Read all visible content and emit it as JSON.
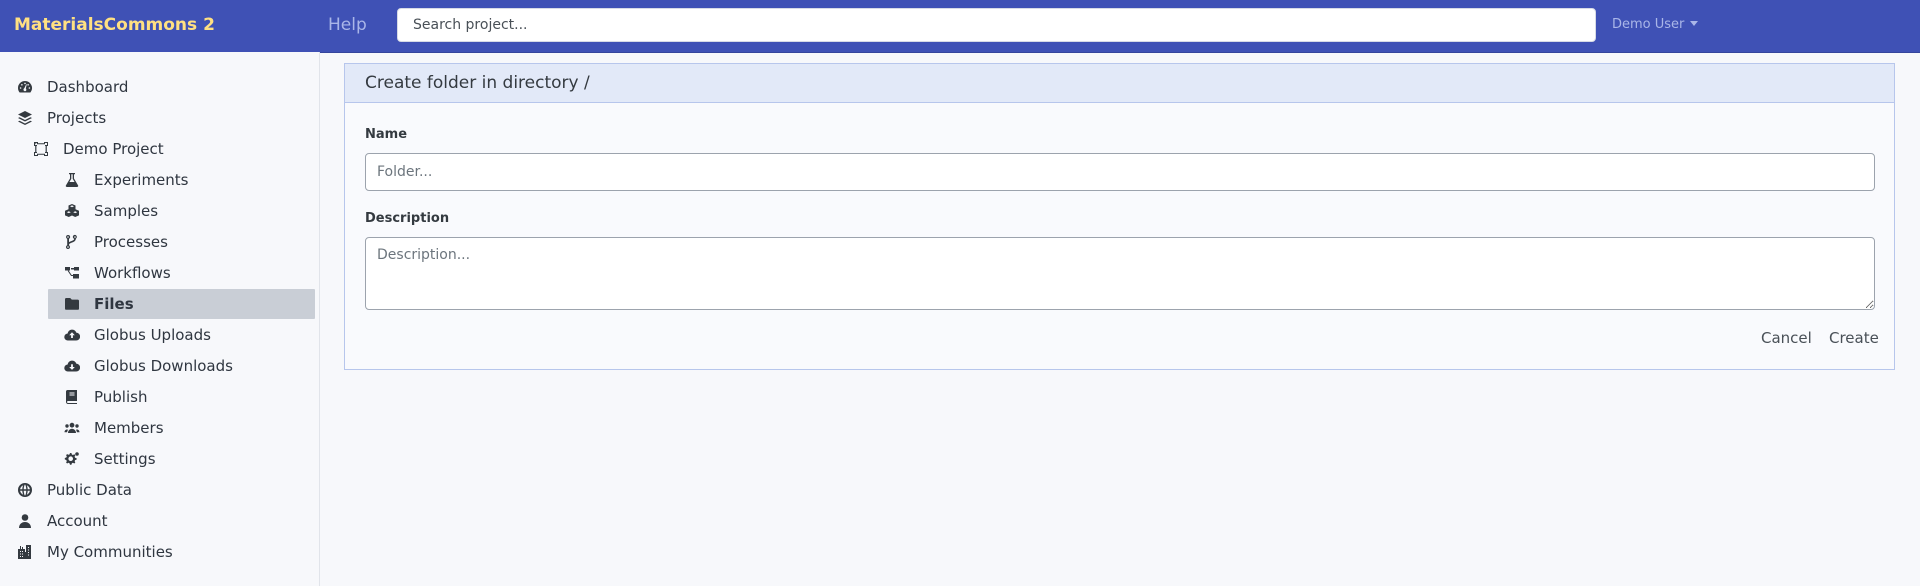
{
  "app": {
    "brand": "MaterialsCommons 2",
    "help_label": "Help",
    "search_placeholder": "Search project...",
    "user_label": "Demo User"
  },
  "sidebar": {
    "dashboard": "Dashboard",
    "projects": "Projects",
    "project_name": "Demo Project",
    "project_items": [
      {
        "label": "Experiments",
        "icon": "flask-icon"
      },
      {
        "label": "Samples",
        "icon": "cubes-icon"
      },
      {
        "label": "Processes",
        "icon": "code-branch-icon"
      },
      {
        "label": "Workflows",
        "icon": "project-diagram-icon"
      },
      {
        "label": "Files",
        "icon": "folder-icon",
        "active": true
      },
      {
        "label": "Globus Uploads",
        "icon": "cloud-upload-icon"
      },
      {
        "label": "Globus Downloads",
        "icon": "cloud-download-icon"
      },
      {
        "label": "Publish",
        "icon": "book-icon"
      },
      {
        "label": "Members",
        "icon": "users-icon"
      },
      {
        "label": "Settings",
        "icon": "cogs-icon"
      }
    ],
    "public_data": "Public Data",
    "account": "Account",
    "communities": "My Communities"
  },
  "form": {
    "title": "Create folder in directory /",
    "name_label": "Name",
    "name_placeholder": "Folder...",
    "description_label": "Description",
    "description_placeholder": "Description...",
    "cancel_label": "Cancel",
    "create_label": "Create"
  },
  "colors": {
    "navbar": "#3f51b5",
    "brand": "#ffe082",
    "active_item": "#c9ced6",
    "card_header": "#e2e9f8"
  }
}
